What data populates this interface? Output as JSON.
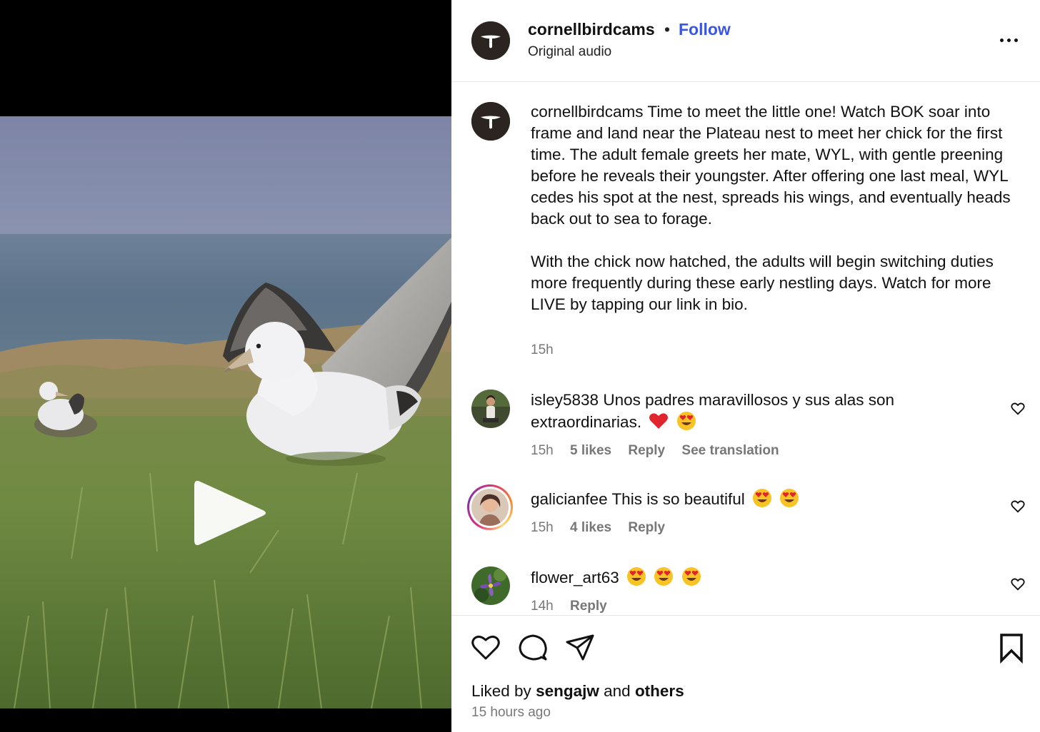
{
  "header": {
    "username": "cornellbirdcams",
    "separator": "•",
    "follow_label": "Follow",
    "audio": "Original audio"
  },
  "caption": {
    "username": "cornellbirdcams",
    "paragraph1": "Time to meet the little one! Watch BOK soar into frame and land near the Plateau nest to meet her chick for the first time. The adult female greets her mate, WYL, with gentle preening before he reveals their youngster. After offering one last meal, WYL cedes his spot at the nest, spreads his wings, and eventually heads back out to sea to forage.",
    "paragraph2": "With the chick now hatched, the adults will begin switching duties more frequently during these early nestling days. Watch for more LIVE by tapping our link in bio.",
    "time": "15h"
  },
  "comments": [
    {
      "username": "isley5838",
      "text": "Unos padres maravillosos y sus alas son extraordinarias.",
      "emojis": [
        "heart",
        "heart-eyes"
      ],
      "time": "15h",
      "likes": "5 likes",
      "reply": "Reply",
      "translate": "See translation"
    },
    {
      "username": "galicianfee",
      "text": "This is so beautiful",
      "emojis": [
        "heart-eyes",
        "heart-eyes"
      ],
      "time": "15h",
      "likes": "4 likes",
      "reply": "Reply"
    },
    {
      "username": "flower_art63",
      "text": "",
      "emojis": [
        "heart-eyes",
        "heart-eyes",
        "heart-eyes"
      ],
      "time": "14h",
      "reply": "Reply"
    }
  ],
  "footer": {
    "liked_prefix": "Liked by",
    "liked_user": "sengajw",
    "liked_and": "and",
    "liked_others": "others",
    "post_time": "15 hours ago"
  },
  "icons": {
    "like": "heart-outline-icon",
    "comment": "comment-bubble-icon",
    "share": "paper-plane-icon",
    "save": "bookmark-icon",
    "more": "more-horizontal-icon",
    "play": "play-icon"
  },
  "colors": {
    "follow": "#3a55e6",
    "muted_text": "#777777",
    "emoji_heart": "#e0252f",
    "emoji_face": "#f7c325"
  }
}
